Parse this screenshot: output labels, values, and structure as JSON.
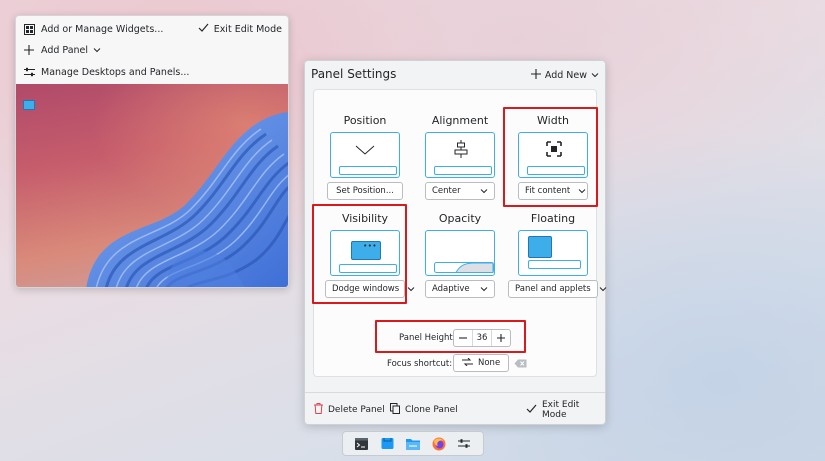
{
  "menu": {
    "add_widgets": "Add or Manage Widgets...",
    "exit_edit_mode": "Exit Edit Mode",
    "add_panel": "Add Panel",
    "manage_desktops": "Manage Desktops and Panels..."
  },
  "panel_settings": {
    "title": "Panel Settings",
    "add_new": "Add New",
    "position": {
      "label": "Position",
      "button": "Set Position..."
    },
    "alignment": {
      "label": "Alignment",
      "value": "Center"
    },
    "width": {
      "label": "Width",
      "value": "Fit content"
    },
    "visibility": {
      "label": "Visibility",
      "value": "Dodge windows"
    },
    "opacity": {
      "label": "Opacity",
      "value": "Adaptive"
    },
    "floating": {
      "label": "Floating",
      "value": "Panel and applets"
    },
    "panel_height": {
      "label": "Panel Height:",
      "value": "36"
    },
    "focus_shortcut": {
      "label": "Focus shortcut:",
      "value": "None"
    },
    "delete_panel": "Delete Panel",
    "clone_panel": "Clone Panel",
    "exit_edit_mode": "Exit Edit Mode"
  },
  "colors": {
    "accent": "#3daee9",
    "highlight": "#d8191e",
    "danger": "#da4453"
  },
  "taskbar": {
    "icons": [
      "terminal-icon",
      "discover-icon",
      "file-manager-icon",
      "firefox-icon",
      "settings-icon"
    ]
  }
}
